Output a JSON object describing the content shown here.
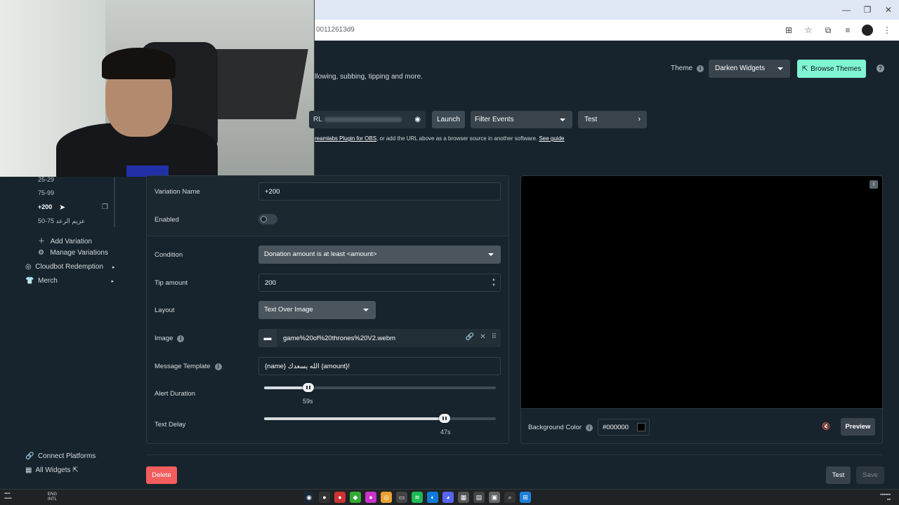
{
  "browser": {
    "url": "00112613d9",
    "window_controls": [
      "minimize",
      "maximize",
      "close"
    ]
  },
  "header": {
    "description": "llowing, subbing, tipping and more.",
    "theme_label": "Theme",
    "theme_value": "Darken Widgets",
    "browse_themes_label": "Browse Themes"
  },
  "toolbar": {
    "url_prefix": "RL",
    "launch_label": "Launch",
    "filter_label": "Filter Events",
    "test_label": "Test",
    "guide_prefix": "reamlabs Plugin for OBS",
    "guide_middle": ", or add the URL above as a browser source in another software. ",
    "guide_link": "See guide"
  },
  "sidebar": {
    "variations": [
      "25-29",
      "75-99",
      "+200",
      "50-75 عزيم الرعد"
    ],
    "active_variation": "+200",
    "add_variation": "Add Variation",
    "manage_variations": "Manage Variations",
    "cloudbot": "Cloudbot Redemption",
    "merch": "Merch",
    "connect_platforms": "Connect Platforms",
    "all_widgets": "All Widgets"
  },
  "form": {
    "variation_name_label": "Variation Name",
    "variation_name_value": "+200",
    "enabled_label": "Enabled",
    "condition_label": "Condition",
    "condition_value": "Donation amount is at least <amount>",
    "tip_amount_label": "Tip amount",
    "tip_amount_value": "200",
    "layout_label": "Layout",
    "layout_value": "Text Over Image",
    "image_label": "Image",
    "image_value": "game%20of%20thrones%20V2.webm",
    "message_template_label": "Message Template",
    "message_template_value": "{name} الله يسعدك {amount}!",
    "alert_duration_label": "Alert Duration",
    "alert_duration_value": "59s",
    "alert_duration_fraction": 0.19,
    "text_delay_label": "Text Delay",
    "text_delay_value": "47s",
    "text_delay_fraction": 0.78
  },
  "preview": {
    "background_color_label": "Background Color",
    "background_color_value": "#000000",
    "preview_label": "Preview"
  },
  "footer": {
    "delete_label": "Delete",
    "test_label": "Test",
    "save_label": "Save"
  },
  "taskbar": {
    "lang_line1": "ENG",
    "lang_line2": "INTL"
  },
  "colors": {
    "background": "#17242d",
    "accent": "#80f5d2",
    "danger": "#f25d5d"
  }
}
